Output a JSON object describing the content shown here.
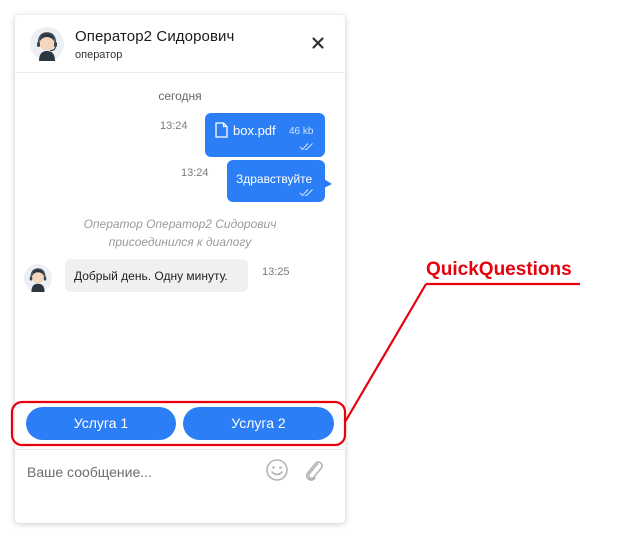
{
  "header": {
    "operator_name": "Оператор2 Сидорович",
    "operator_role": "оператор",
    "avatar_icon": "operator-headset-avatar-icon",
    "close_icon": "close-icon"
  },
  "messages": {
    "date_label": "сегодня",
    "file_message": {
      "time": "13:24",
      "file_name": "box.pdf",
      "file_size": "46 kb",
      "icon": "file-icon",
      "status_icon": "double-check-icon"
    },
    "text_message": {
      "time": "13:24",
      "text": "Здравствуйте",
      "status_icon": "double-check-icon"
    },
    "system_message_line1": "Оператор Оператор2 Сидорович",
    "system_message_line2": "присоединился к диалогу",
    "operator_message": {
      "time": "13:25",
      "text": "Добрый день. Одну минуту."
    }
  },
  "quick_questions": {
    "buttons": [
      "Услуга 1",
      "Услуга 2"
    ]
  },
  "composer": {
    "placeholder": "Ваше сообщение...",
    "emoji_icon": "smiley-icon",
    "attach_icon": "paperclip-icon"
  },
  "annotation": {
    "label": "QuickQuestions"
  },
  "colors": {
    "accent": "#2b7ef5",
    "annotation": "#e8000d",
    "incoming_bubble": "#f0f0f0"
  }
}
